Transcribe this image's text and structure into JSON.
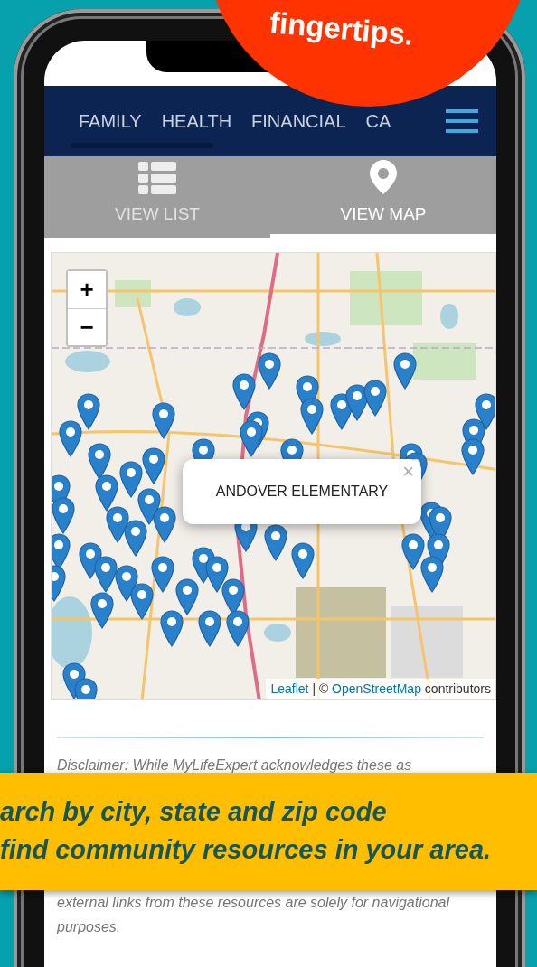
{
  "promo_badge": {
    "text": "fingertips."
  },
  "nav": {
    "tabs": [
      {
        "label": "FAMILY"
      },
      {
        "label": "HEALTH"
      },
      {
        "label": "FINANCIAL"
      },
      {
        "label": "CA"
      }
    ]
  },
  "view_tabs": [
    {
      "label": "VIEW LIST",
      "kind": "list",
      "selected": false
    },
    {
      "label": "VIEW MAP",
      "kind": "map",
      "selected": true
    }
  ],
  "map": {
    "zoom_buttons": [
      "+",
      "−"
    ],
    "popup": {
      "title": "ANDOVER ELEMENTARY",
      "close": "×"
    },
    "attribution": [
      {
        "kind": "link",
        "text": "Leaflet"
      },
      {
        "kind": "text",
        "text": "| ©"
      },
      {
        "kind": "link",
        "text": "OpenStreetMap"
      },
      {
        "kind": "text",
        "text": "contributors"
      }
    ]
  },
  "disclaimer": {
    "top": "Disclaimer: While MyLifeExpert acknowledges these as",
    "bottom": "external links from these resources are solely for navigational purposes."
  },
  "promo_banner": [
    "arch by city, state and zip code",
    "find community resources in your area."
  ]
}
